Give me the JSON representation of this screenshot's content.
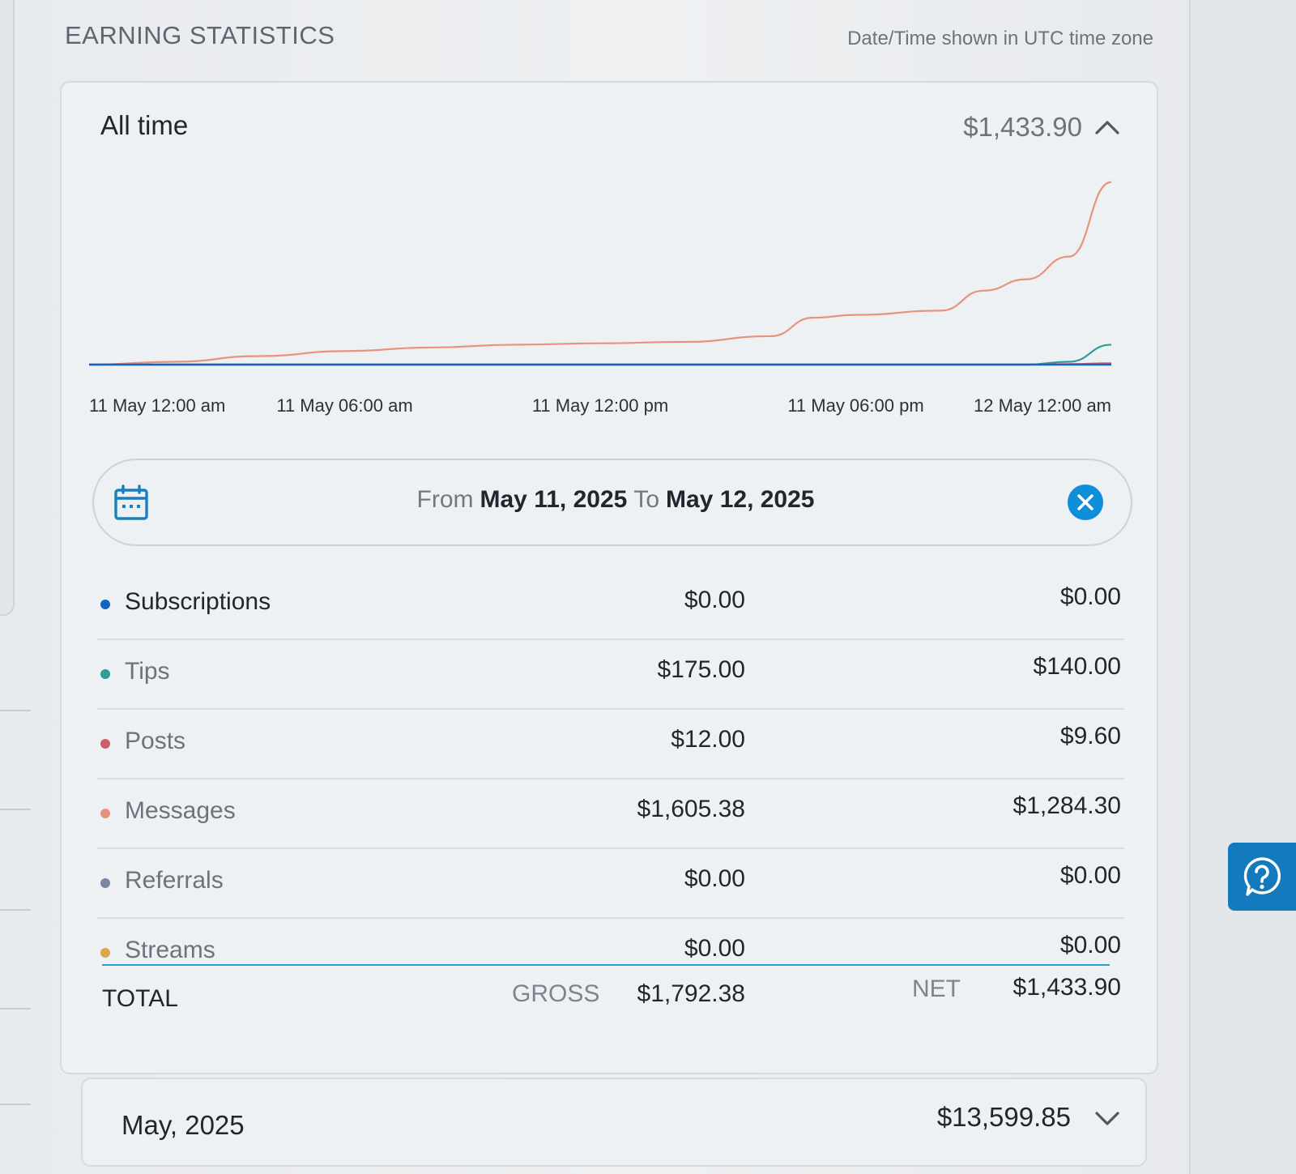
{
  "header": {
    "title": "EARNING STATISTICS",
    "timezone_note": "Date/Time shown in UTC time zone"
  },
  "card": {
    "title": "All time",
    "amount": "$1,433.90"
  },
  "chart_data": {
    "type": "line",
    "x_tick_labels": [
      "11 May 12:00 am",
      "11 May 06:00 am",
      "11 May 12:00 pm",
      "11 May 06:00 pm",
      "12 May 12:00 am"
    ],
    "x_hours": [
      0,
      2,
      4,
      6,
      8,
      10,
      12,
      14,
      16,
      17,
      18,
      20,
      21,
      22,
      23,
      24
    ],
    "series": [
      {
        "color": "#e8927e",
        "values": [
          0,
          20,
          60,
          95,
          120,
          140,
          150,
          160,
          200,
          330,
          350,
          380,
          520,
          600,
          760,
          1284.3
        ]
      },
      {
        "color": "#2b9e9a",
        "values": [
          0,
          0,
          0,
          0,
          0,
          0,
          0,
          0,
          0,
          0,
          0,
          0,
          0,
          0,
          20,
          140
        ]
      },
      {
        "color": "#c95f6d",
        "values": [
          0,
          0,
          0,
          0,
          0,
          0,
          0,
          0,
          0,
          0,
          0,
          0,
          0,
          0,
          4,
          9.6
        ]
      },
      {
        "color": "#1565c0",
        "values": [
          0,
          0,
          0,
          0,
          0,
          0,
          0,
          0,
          0,
          0,
          0,
          0,
          0,
          0,
          0,
          0
        ]
      }
    ],
    "ylim": [
      0,
      1300
    ],
    "grid": false
  },
  "date_range": {
    "from_label": "From",
    "from": "May 11, 2025",
    "to_label": "To",
    "to": "May 12, 2025"
  },
  "rows": [
    {
      "name": "Subscriptions",
      "gross": "$0.00",
      "net": "$0.00",
      "color": "#1565c0"
    },
    {
      "name": "Tips",
      "gross": "$175.00",
      "net": "$140.00",
      "color": "#2b9e9a"
    },
    {
      "name": "Posts",
      "gross": "$12.00",
      "net": "$9.60",
      "color": "#c95f6d"
    },
    {
      "name": "Messages",
      "gross": "$1,605.38",
      "net": "$1,284.30",
      "color": "#e8927e"
    },
    {
      "name": "Referrals",
      "gross": "$0.00",
      "net": "$0.00",
      "color": "#7b86a6"
    },
    {
      "name": "Streams",
      "gross": "$0.00",
      "net": "$0.00",
      "color": "#e0a64a"
    }
  ],
  "total": {
    "label": "TOTAL",
    "gross_label": "GROSS",
    "gross": "$1,792.38",
    "net_label": "NET",
    "net": "$1,433.90"
  },
  "month_card": {
    "title": "May, 2025",
    "amount": "$13,599.85"
  },
  "icons": {
    "calendar": "calendar-icon",
    "clear": "close-icon",
    "collapse": "chevron-up-icon",
    "expand": "chevron-down-icon",
    "help": "help-icon"
  }
}
